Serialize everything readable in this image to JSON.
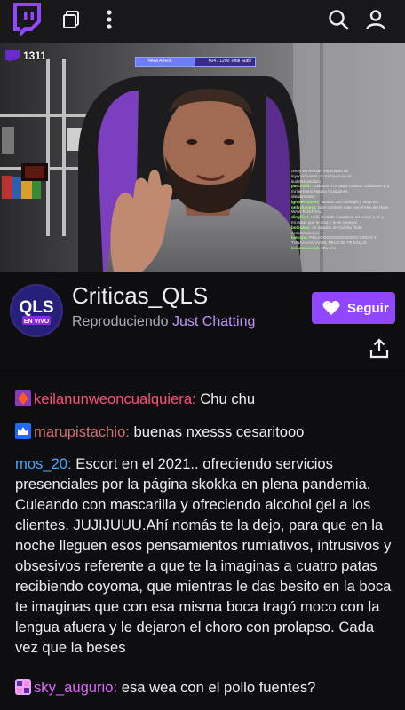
{
  "topbar": {
    "icons": [
      "twitch-logo",
      "picture-in-picture-icon",
      "more-vertical-icon",
      "search-icon",
      "profile-icon"
    ]
  },
  "video": {
    "viewer_count": "1311",
    "goal_label": "PARA ABRIL",
    "goal_count": "604 / 1200 Total Subs",
    "goal_progress": 0.5,
    "overlay_chat": [
      {
        "name": "",
        "text": "omey en vietnam esperando mi"
      },
      {
        "name": "",
        "text": "inyección letal, no trafiquen en el"
      },
      {
        "name": "",
        "text": "sudeste asiático"
      },
      {
        "name": "parchakil7:",
        "text": "Saludos a mi papá Cristian Galdames y a"
      },
      {
        "name": "",
        "text": "mi hermano Natalia (Galdames,"
      },
      {
        "name": "",
        "text": "idealamente)"
      },
      {
        "name": "ignisecuruder:",
        "text": "Vamian con midnight y sega bro"
      },
      {
        "name": "onlyskanerg:",
        "text": "Nice subimos mas con el tren del Hype"
      },
      {
        "name": "",
        "text": "WAW RUSTRAL"
      },
      {
        "name": "dingfivet:",
        "text": "Hola cesarito mandame un besito a mi y"
      },
      {
        "name": "",
        "text": "mi mami que te ama y te ve siempre"
      },
      {
        "name": "bolonkos:",
        "text": "un saludos de Cemba rbabl"
      },
      {
        "name": "",
        "text": "cesaritooooooo"
      },
      {
        "name": "luecuno:",
        "text": "PELAOOOOOOOOOOOO CREZA Y"
      },
      {
        "name": "",
        "text": "TUNAAAAAAAA EL PELO SE TE KALLO"
      },
      {
        "name": "keilanunweon:",
        "text": "Chu chu"
      }
    ]
  },
  "channel": {
    "name": "Criticas_QLS",
    "status_prefix": "Reproduciendo",
    "game": "Just Chatting",
    "follow_label": "Seguir",
    "avatar_text_top": "QLS",
    "avatar_text_bottom": "EN VIVO"
  },
  "chat": {
    "messages": [
      {
        "user": "keilanunweoncualquiera:",
        "text": "Chu chu",
        "user_color": "#ff4f7a",
        "badge": "diamond-badge"
      },
      {
        "user": "marupistachio:",
        "text": "buenas nxesss cesaritooo",
        "user_color": "#d07070",
        "badge": "crown-badge"
      },
      {
        "user": "mos_20:",
        "text": "Escort en el 2021.. ofreciendo servicios presenciales por la página skokka en plena pandemia. Culeando con mascarilla y ofreciendo alcohol gel a los clientes. JUJIJUUU.Ahí nomás te la dejo, para que en la noche lleguen esos pensamientos rumiativos, intrusivos y obsesivos referente a que te la imaginas a cuatro patas recibiendo coyoma, que mientras le das besito en la boca te imaginas que con esa misma boca tragó moco con la lengua afuera y le dejaron el choro con prolapso. Cada vez que la beses",
        "user_color": "#3fa9ff",
        "badge": ""
      },
      {
        "user": "sky_augurio:",
        "text": "esa wea con el pollo fuentes?",
        "user_color": "#e066ff",
        "badge": "sub-badge"
      }
    ]
  },
  "colors": {
    "accent": "#9147ff",
    "game_link": "#bf94ff",
    "background": "#0e0e10",
    "topbar": "#18181b"
  }
}
